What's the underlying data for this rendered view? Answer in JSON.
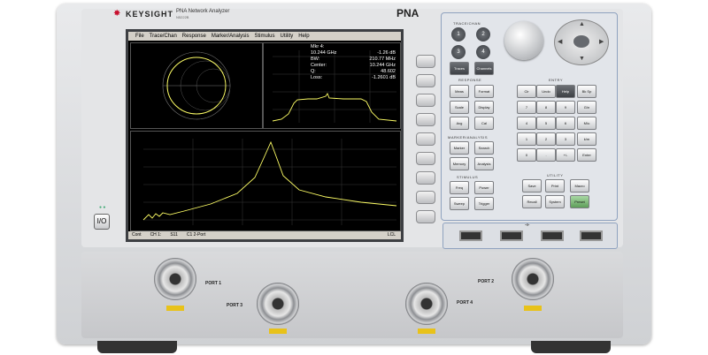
{
  "brand": {
    "name": "KEYSIGHT",
    "product": "PNA Network Analyzer",
    "model": "PNA",
    "model_sub": "N5222B"
  },
  "menu": [
    "File",
    "Trace/Chan",
    "Response",
    "Marker/Analysis",
    "Stimulus",
    "Utility",
    "Help"
  ],
  "readout": [
    {
      "label": "Mkr 4:",
      "value": ""
    },
    {
      "label": "10.244 GHz",
      "value": "-1.26 dB"
    },
    {
      "label": "BW:",
      "value": "210.77 MHz"
    },
    {
      "label": "Center:",
      "value": "10.244 GHz"
    },
    {
      "label": "Q:",
      "value": "48.602"
    },
    {
      "label": "Loss:",
      "value": "-1.2601 dB"
    }
  ],
  "status": [
    "Cont",
    "CH 1:",
    "S11",
    "C1 2-Port",
    "LCL"
  ],
  "sections": {
    "trace_chan": "TRACE/CHAN",
    "response": "RESPONSE",
    "entry": "ENTRY",
    "marker": "MARKER/ANALYSIS",
    "stimulus": "STIMULUS",
    "utility": "UTILITY"
  },
  "keys": {
    "trace_chan": [
      "1",
      "2",
      "3",
      "4",
      "Traces",
      "Channels"
    ],
    "response": [
      "Meas",
      "Format",
      "Scale",
      "Display",
      "Avg",
      "Cal"
    ],
    "marker": [
      "Marker",
      "Search",
      "Memory",
      "Analysis"
    ],
    "stimulus": [
      "Freq",
      "Power",
      "Sweep",
      "Trigger"
    ],
    "utility": [
      "Save",
      "Print",
      "Macro",
      "Recall",
      "System",
      "Preset"
    ],
    "entry": [
      "Clr",
      "Undo",
      "Help",
      "Bk Sp",
      "7",
      "8",
      "9",
      "G/n",
      "4",
      "5",
      "6",
      "M/u",
      "1",
      "2",
      "3",
      "k/m",
      "0",
      ".",
      "+/-",
      "Enter"
    ]
  },
  "ports": [
    "PORT 1",
    "PORT 2",
    "PORT 3",
    "PORT 4"
  ],
  "power_label": "I/O"
}
